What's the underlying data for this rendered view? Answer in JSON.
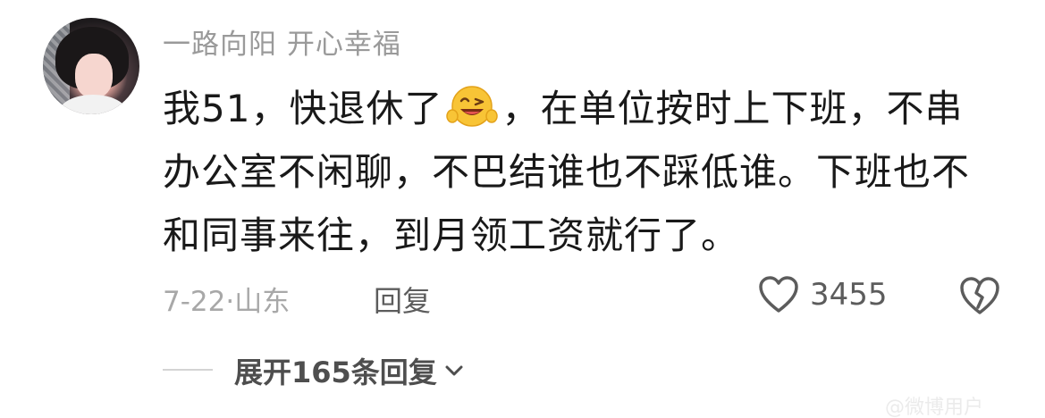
{
  "comment": {
    "username": "一路向阳  开心幸福",
    "content_part1": "我51，快退休了",
    "emoji": "grinning-wink-emoji",
    "content_part2": "，在单位按时上下班，不串办公室不闲聊，不巴结谁也不踩低谁。下班也不和同事来往，到月领工资就行了。",
    "meta": "7-22·山东",
    "reply_label": "回复",
    "like_count": "3455",
    "expand_label": "展开165条回复",
    "watermark": "@微博用户"
  },
  "colors": {
    "text_primary": "#191919",
    "text_secondary": "#9a9a9a",
    "icon": "#5c5c5c"
  }
}
